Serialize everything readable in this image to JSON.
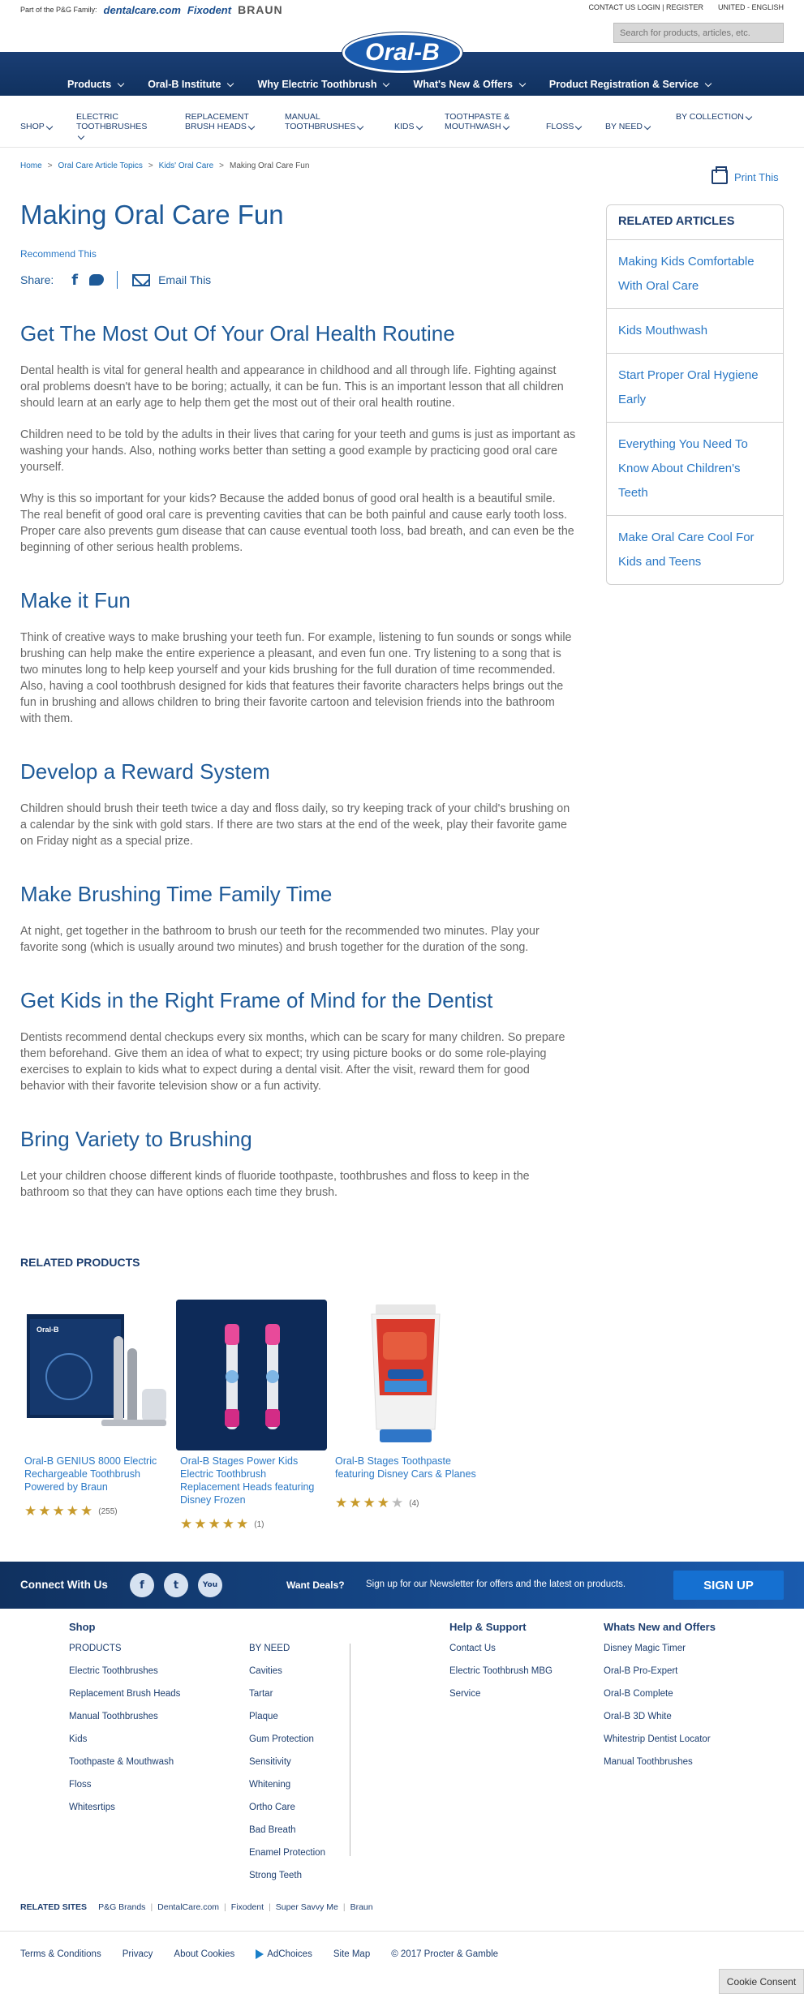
{
  "utility": {
    "family_label": "Part of the P&G Family:",
    "brands": [
      "dentalcare.com",
      "Fixodent",
      "BRAUN"
    ],
    "contact": "CONTACT US",
    "login": "LOGIN | REGISTER",
    "region": "UNITED - ENGLISH"
  },
  "search": {
    "placeholder": "Search for products, articles, etc."
  },
  "logo": "Oral-B",
  "main_nav": [
    "Products",
    "Oral-B Institute",
    "Why Electric Toothbrush",
    "What's New & Offers",
    "Product Registration & Service"
  ],
  "shop_nav": [
    "SHOP",
    "ELECTRIC TOOTHBRUSHES",
    "REPLACEMENT BRUSH HEADS",
    "MANUAL TOOTHBRUSHES",
    "KIDS",
    "TOOTHPASTE & MOUTHWASH",
    "FLOSS",
    "BY NEED",
    "BY COLLECTION"
  ],
  "breadcrumb": [
    "Home",
    "Oral Care Article Topics",
    "Kids' Oral Care",
    "Making Oral Care Fun"
  ],
  "print_label": "Print This",
  "article": {
    "title": "Making Oral Care Fun",
    "recommend": "Recommend This",
    "share_label": "Share:",
    "email_label": "Email This",
    "sections": [
      {
        "heading": "Get The Most Out Of Your Oral Health Routine",
        "paragraphs": [
          "Dental health is vital for general health and appearance in childhood and all through life. Fighting against oral problems doesn't have to be boring; actually, it can be fun. This is an important lesson that all children should learn at an early age to help them get the most out of their oral health routine.",
          "Children need to be told by the adults in their lives that caring for your teeth and gums is just as important as washing your hands. Also, nothing works better than setting a good example by practicing good oral care yourself.",
          "Why is this so important for your kids? Because the added bonus of good oral health is a beautiful smile. The real benefit of good oral care is preventing cavities that can be both painful and cause early tooth loss. Proper care also prevents gum disease that can cause eventual tooth loss, bad breath, and can even be the beginning of other serious health problems."
        ]
      },
      {
        "heading": "Make it Fun",
        "paragraphs": [
          "Think of creative ways to make brushing your teeth fun. For example, listening to fun sounds or songs while brushing can help make the entire experience a pleasant, and even fun one. Try listening to a song that is two minutes long to help keep yourself and your kids brushing for the full duration of time recommended. Also, having a cool toothbrush designed for kids that features their favorite characters helps brings out the fun in brushing and allows children to bring their favorite cartoon and television friends into the bathroom with them."
        ]
      },
      {
        "heading": "Develop a Reward System",
        "paragraphs": [
          "Children should brush their teeth twice a day and floss daily, so try keeping track of your child's brushing on a calendar by the sink with gold stars. If there are two stars at the end of the week, play their favorite game on Friday night as a special prize."
        ]
      },
      {
        "heading": "Make Brushing Time Family Time",
        "paragraphs": [
          "At night, get together in the bathroom to brush our teeth for the recommended two minutes. Play your favorite song (which is usually around two minutes) and brush together for the duration of the song."
        ]
      },
      {
        "heading": "Get Kids in the Right Frame of Mind for the Dentist",
        "paragraphs": [
          "Dentists recommend dental checkups every six months, which can be scary for many children. So prepare them beforehand. Give them an idea of what to expect; try using picture books or do some role-playing exercises to explain to kids what to expect during a dental visit. After the visit, reward them for good behavior with their favorite television show or a fun activity."
        ]
      },
      {
        "heading": "Bring Variety to Brushing",
        "paragraphs": [
          "Let your children choose different kinds of fluoride toothpaste, toothbrushes and floss to keep in the bathroom so that they can have options each time they brush."
        ]
      }
    ]
  },
  "sidebar": {
    "title": "RELATED ARTICLES",
    "links": [
      "Making Kids Comfortable With Oral Care",
      "Kids Mouthwash",
      "Start Proper Oral Hygiene Early",
      "Everything You Need To Know About Children's Teeth",
      "Make Oral Care Cool For Kids and Teens"
    ]
  },
  "related_products": {
    "title": "RELATED PRODUCTS",
    "items": [
      {
        "name": "Oral-B GENIUS 8000 Electric Rechargeable Toothbrush Powered by Braun",
        "stars": 5,
        "count": "(255)"
      },
      {
        "name": "Oral-B Stages Power Kids Electric Toothbrush Replacement Heads featuring Disney Frozen",
        "stars": 5,
        "count": "(1)"
      },
      {
        "name": "Oral-B Stages Toothpaste featuring Disney Cars & Planes",
        "stars": 4,
        "count": "(4)"
      }
    ]
  },
  "connect": {
    "label": "Connect With Us",
    "deals": "Want Deals?",
    "newsletter": "Sign up for our Newsletter for offers and the latest on products.",
    "signup": "SIGN UP",
    "social": [
      "f",
      "t",
      "You"
    ]
  },
  "footer": {
    "shop_title": "Shop",
    "products_col": [
      "PRODUCTS",
      "Electric Toothbrushes",
      "Replacement Brush Heads",
      "Manual Toothbrushes",
      "Kids",
      "Toothpaste & Mouthwash",
      "Floss",
      "Whitesrtips"
    ],
    "need_col": [
      "BY NEED",
      "Cavities",
      "Tartar",
      "Plaque",
      "Gum Protection",
      "Sensitivity",
      "Whitening",
      "Ortho Care",
      "Bad Breath",
      "Enamel Protection",
      "Strong Teeth"
    ],
    "help_title": "Help & Support",
    "help_col": [
      "Contact Us",
      "Electric Toothbrush MBG",
      "Service"
    ],
    "new_title": "Whats New and Offers",
    "new_col": [
      "Disney Magic Timer",
      "Oral-B Pro-Expert",
      "Oral-B Complete",
      "Oral-B 3D White",
      "Whitestrip Dentist Locator",
      "Manual Toothbrushes"
    ],
    "related_sites_title": "RELATED SITES",
    "related_sites": [
      "P&G Brands",
      "DentalCare.com",
      "Fixodent",
      "Super Savvy Me",
      "Braun"
    ],
    "bottom_links": [
      "Terms & Conditions",
      "Privacy",
      "About Cookies",
      "AdChoices",
      "Site Map",
      "© 2017 Procter & Gamble"
    ]
  },
  "cookie_consent": "Cookie Consent"
}
